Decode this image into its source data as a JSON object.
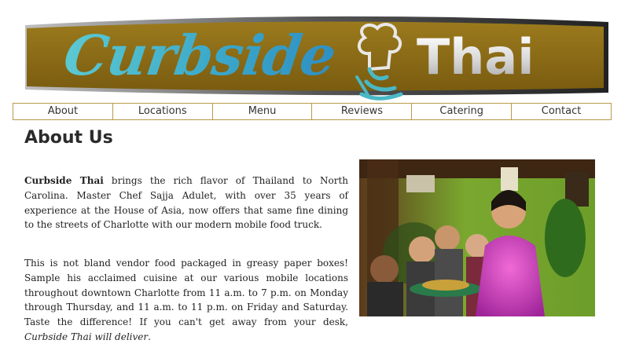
{
  "brand": {
    "name_part_1": "Curbside",
    "name_part_2": "Thai",
    "colors": {
      "banner_bg": "#8a6b18",
      "banner_accent": "#49b8c5",
      "nav_border": "#b89a4a"
    }
  },
  "nav": {
    "items": [
      {
        "label": "About"
      },
      {
        "label": "Locations"
      },
      {
        "label": "Menu"
      },
      {
        "label": "Reviews"
      },
      {
        "label": "Catering"
      },
      {
        "label": "Contact"
      }
    ]
  },
  "main": {
    "title": "About Us",
    "paragraph_1": {
      "lead": "Curbside Thai",
      "text": " brings the rich flavor of Thailand to North Carolina. Master Chef Sajja Adulet, with over 35 years of experience at the House of Asia, now offers that same fine dining to the streets of Charlotte with our modern mobile food truck."
    },
    "paragraph_2": {
      "text": "This is not bland vendor food packaged in greasy paper boxes! Sample his acclaimed cuisine at our various mobile locations throughout downtown Charlotte from 11 a.m. to 7 p.m. on Monday through Thursday, and 11 a.m. to 11 p.m. on Friday and Saturday. Taste the difference! If you can't get away from your desk, ",
      "emphasis": "Curbside Thai will deliver",
      "end": "."
    },
    "photo": {
      "icon": "restaurant-photo"
    }
  }
}
